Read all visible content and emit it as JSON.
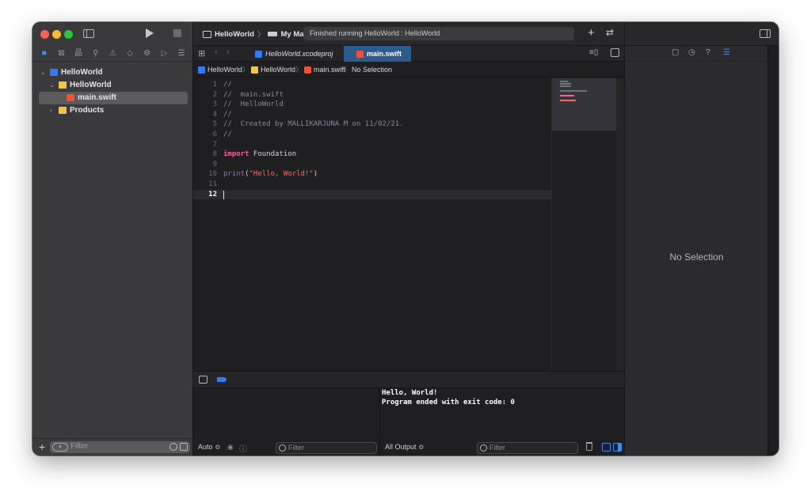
{
  "toolbar": {
    "scheme_project": "HelloWorld",
    "scheme_sep": "〉",
    "scheme_destination": "My Mac",
    "activity_status": "Finished running HelloWorld : HelloWorld",
    "add_label": "+",
    "swap_label": "⇄"
  },
  "navigator": {
    "icons": [
      "folder-icon",
      "source-control-icon",
      "symbol-icon",
      "find-icon",
      "issue-icon",
      "test-icon",
      "debug-icon",
      "breakpoint-icon",
      "report-icon"
    ],
    "tree": [
      {
        "label": "HelloWorld",
        "kind": "project",
        "disclosure": "⌄"
      },
      {
        "label": "HelloWorld",
        "kind": "folder",
        "disclosure": "⌄"
      },
      {
        "label": "main.swift",
        "kind": "swift",
        "disclosure": ""
      },
      {
        "label": "Products",
        "kind": "folder",
        "disclosure": "›"
      }
    ],
    "add_label": "+",
    "filter_placeholder": "Filter"
  },
  "tabs": [
    {
      "label": "HelloWorld.xcodeproj",
      "active": false
    },
    {
      "label": "main.swift",
      "active": true
    }
  ],
  "jumpbar": [
    {
      "label": "HelloWorld",
      "icon": "project-icon"
    },
    {
      "label": "HelloWorld",
      "icon": "folder-icon"
    },
    {
      "label": "main.swift",
      "icon": "swift-file-icon"
    },
    {
      "label": "No Selection",
      "icon": ""
    }
  ],
  "jumpbar_sep": "〉",
  "editor": {
    "current_line": 12,
    "lines": [
      {
        "n": "1",
        "tokens": [
          {
            "t": "cm",
            "v": "//"
          }
        ]
      },
      {
        "n": "2",
        "tokens": [
          {
            "t": "cm",
            "v": "//  main.swift"
          }
        ]
      },
      {
        "n": "3",
        "tokens": [
          {
            "t": "cm",
            "v": "//  HelloWorld"
          }
        ]
      },
      {
        "n": "4",
        "tokens": [
          {
            "t": "cm",
            "v": "//"
          }
        ]
      },
      {
        "n": "5",
        "tokens": [
          {
            "t": "cm",
            "v": "//  Created by MALLIKARJUNA M on 11/02/21."
          }
        ]
      },
      {
        "n": "6",
        "tokens": [
          {
            "t": "cm",
            "v": "//"
          }
        ]
      },
      {
        "n": "7",
        "tokens": []
      },
      {
        "n": "8",
        "tokens": [
          {
            "t": "kw",
            "v": "import"
          },
          {
            "t": "id",
            "v": " Foundation"
          }
        ]
      },
      {
        "n": "9",
        "tokens": []
      },
      {
        "n": "10",
        "tokens": [
          {
            "t": "fn",
            "v": "print"
          },
          {
            "t": "id",
            "v": "("
          },
          {
            "t": "str",
            "v": "\"Hello, World!\""
          },
          {
            "t": "id",
            "v": ")"
          }
        ]
      },
      {
        "n": "11",
        "tokens": []
      },
      {
        "n": "12",
        "tokens": []
      }
    ]
  },
  "console": {
    "lines": [
      "Hello, World!",
      "Program ended with exit code: 0"
    ],
    "output_selector": "All Output ≎",
    "filter_placeholder": "Filter"
  },
  "variables": {
    "scope_selector": "Auto ≎",
    "filter_placeholder": "Filter"
  },
  "inspector": {
    "tabs": [
      "file-inspector-icon",
      "history-icon",
      "help-icon",
      "attributes-icon"
    ],
    "empty_label": "No Selection"
  },
  "colors": {
    "accent": "#3d8df5",
    "keyword": "#fc5fa3",
    "string": "#fc6a5d",
    "function": "#a167e6",
    "comment": "#7f8c98"
  }
}
